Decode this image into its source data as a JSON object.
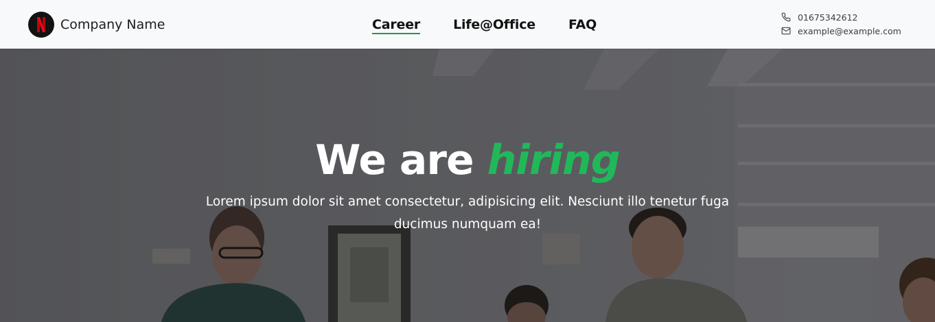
{
  "header": {
    "logo_letter": "N",
    "company_name": "Company Name",
    "nav": [
      {
        "label": "Career",
        "active": true
      },
      {
        "label": "Life@Office",
        "active": false
      },
      {
        "label": "FAQ",
        "active": false
      }
    ],
    "contact": {
      "phone": "01675342612",
      "email": "example@example.com"
    }
  },
  "hero": {
    "title_prefix": "We are",
    "title_accent": "hiring",
    "subtitle": "Lorem ipsum dolor sit amet consectetur, adipisicing elit. Nesciunt illo tenetur fuga ducimus numquam ea!"
  },
  "colors": {
    "accent": "#21b85a",
    "nav_underline": "#1f9a4a",
    "header_bg": "#f8f9fb",
    "logo_red": "#e50914"
  },
  "icons": {
    "phone": "phone-icon",
    "email": "mail-icon"
  }
}
